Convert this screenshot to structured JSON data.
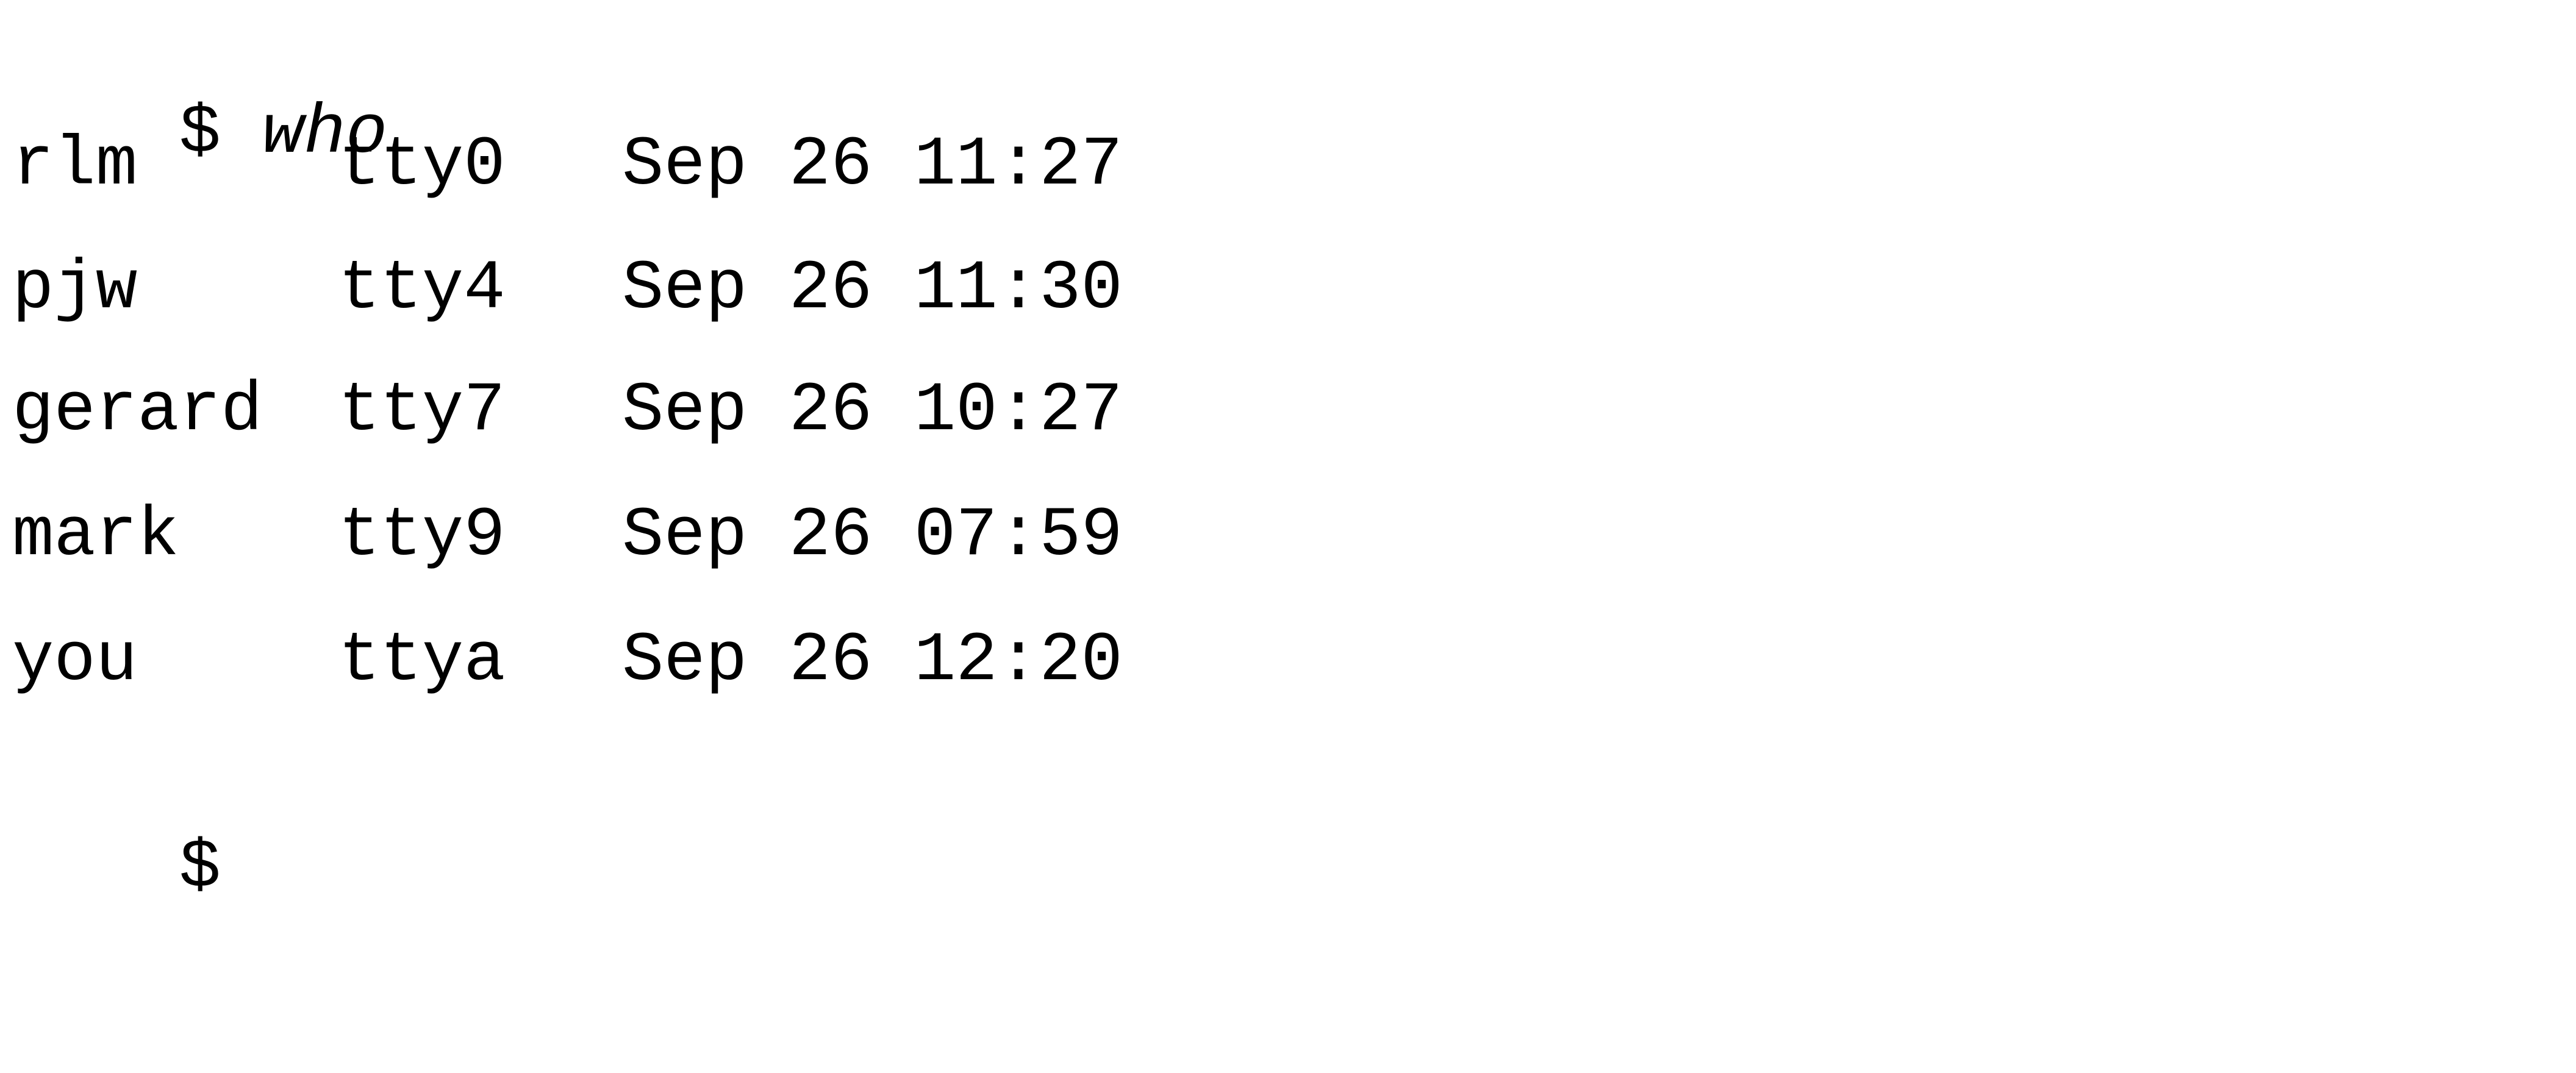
{
  "session": {
    "prompt": "$",
    "command": "who",
    "rows": [
      {
        "user": "rlm",
        "tty": "tty0",
        "date": "Sep 26 11:27"
      },
      {
        "user": "pjw",
        "tty": "tty4",
        "date": "Sep 26 11:30"
      },
      {
        "user": "gerard",
        "tty": "tty7",
        "date": "Sep 26 10:27"
      },
      {
        "user": "mark",
        "tty": "tty9",
        "date": "Sep 26 07:59"
      },
      {
        "user": "you",
        "tty": "ttya",
        "date": "Sep 26 12:20"
      }
    ],
    "final_prompt": "$"
  }
}
